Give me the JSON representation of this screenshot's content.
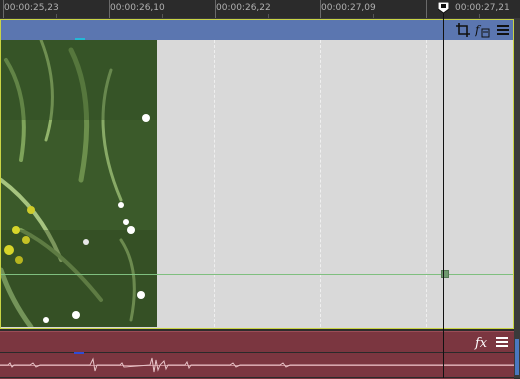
{
  "ruler": {
    "labels": [
      "00:00:25,23",
      "00:00:26,10",
      "00:00:26,22",
      "00:00:27,09",
      "00:00:27,21"
    ]
  },
  "video_track": {
    "color": "#5b76b0",
    "body_color": "#d9d9d9",
    "selection_color": "#c9d445",
    "icons": [
      "crop-icon",
      "fx-media-icon",
      "menu-icon"
    ]
  },
  "audio_track": {
    "color": "#7b3640",
    "icons": [
      "fx-icon",
      "menu-icon"
    ]
  },
  "playhead": {
    "color": "#111111"
  }
}
